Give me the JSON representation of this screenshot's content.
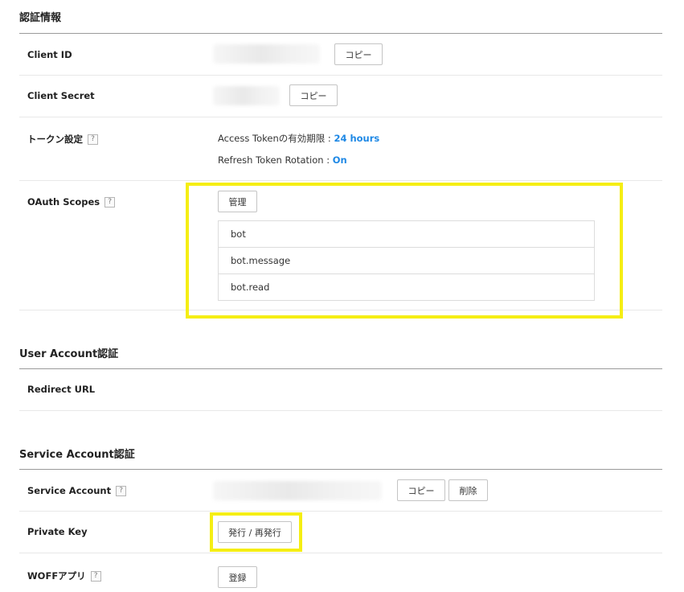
{
  "auth_info": {
    "title": "認証情報",
    "client_id": {
      "label": "Client ID",
      "copy_label": "コピー"
    },
    "client_secret": {
      "label": "Client Secret",
      "copy_label": "コピー"
    },
    "token": {
      "label": "トークン設定",
      "access_token_label": "Access Tokenの有効期限 : ",
      "access_token_value": "24 hours",
      "refresh_label": "Refresh Token Rotation : ",
      "refresh_value": "On"
    },
    "oauth_scopes": {
      "label": "OAuth Scopes",
      "manage_label": "管理",
      "items": [
        "bot",
        "bot.message",
        "bot.read"
      ]
    }
  },
  "user_account": {
    "title": "User Account認証",
    "redirect_url_label": "Redirect URL"
  },
  "service_account": {
    "title": "Service Account認証",
    "account": {
      "label": "Service Account",
      "copy_label": "コピー",
      "delete_label": "削除"
    },
    "private_key": {
      "label": "Private Key",
      "issue_label": "発行 / 再発行"
    },
    "woff": {
      "label": "WOFFアプリ",
      "register_label": "登録"
    }
  },
  "help_glyph": "?",
  "colors": {
    "highlight": "#f5ee14",
    "value_blue": "#1e88e5"
  }
}
